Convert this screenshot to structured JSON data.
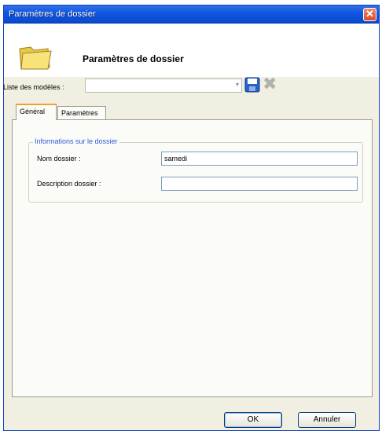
{
  "window": {
    "title": "Paramètres de dossier",
    "close_glyph": "✕"
  },
  "header": {
    "title": "Paramètres de dossier",
    "icon": "folder-icon"
  },
  "models": {
    "label": "Liste des modèles :",
    "selected": "",
    "save_icon": "save-icon",
    "delete_icon": "delete-icon"
  },
  "tabs": [
    {
      "label": "Général",
      "active": true
    },
    {
      "label": "Paramètres",
      "active": false
    }
  ],
  "group": {
    "legend": "Informations sur le dossier",
    "fields": [
      {
        "label": "Nom dossier :",
        "value": "samedi"
      },
      {
        "label": "Description dossier :",
        "value": ""
      }
    ]
  },
  "buttons": {
    "ok": "OK",
    "cancel": "Annuler"
  },
  "colors": {
    "titlebar": "#0a4bd0",
    "legend": "#2f58d8",
    "tab_accent": "#f0a030"
  }
}
